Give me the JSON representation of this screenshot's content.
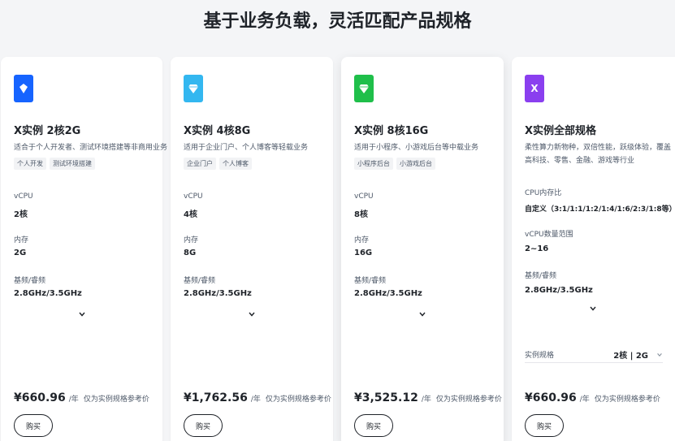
{
  "page_title": "基于业务负载，灵活匹配产品规格",
  "cards": [
    {
      "icon": "diamond-icon",
      "icon_color": "#1664ff",
      "title": "X实例 2核2G",
      "desc": "适合于个人开发者、测试环境搭建等非商用业务",
      "tags": [
        "个人开发",
        "测试环境搭建"
      ],
      "specs": [
        {
          "label": "vCPU",
          "value": "2核"
        },
        {
          "label": "内存",
          "value": "2G"
        },
        {
          "label": "基频/睿频",
          "value": "2.8GHz/3.5GHz"
        }
      ],
      "price": "¥660.96",
      "unit": "/年",
      "note": "仅为实例规格参考价",
      "buy": "购买"
    },
    {
      "icon": "gem-icon",
      "icon_color": "#33b7f0",
      "title": "X实例 4核8G",
      "desc": "适用于企业门户、个人博客等轻载业务",
      "tags": [
        "企业门户",
        "个人博客"
      ],
      "specs": [
        {
          "label": "vCPU",
          "value": "4核"
        },
        {
          "label": "内存",
          "value": "8G"
        },
        {
          "label": "基频/睿频",
          "value": "2.8GHz/3.5GHz"
        }
      ],
      "price": "¥1,762.56",
      "unit": "/年",
      "note": "仅为实例规格参考价",
      "buy": "购买"
    },
    {
      "icon": "gem-icon",
      "icon_color": "#1fbf4a",
      "title": "X实例 8核16G",
      "desc": "适用于小程序、小游戏后台等中载业务",
      "tags": [
        "小程序后台",
        "小游戏后台"
      ],
      "specs": [
        {
          "label": "vCPU",
          "value": "8核"
        },
        {
          "label": "内存",
          "value": "16G"
        },
        {
          "label": "基频/睿频",
          "value": "2.8GHz/3.5GHz"
        }
      ],
      "price": "¥3,525.12",
      "unit": "/年",
      "note": "仅为实例规格参考价",
      "buy": "购买"
    },
    {
      "icon_letter": "X",
      "icon_color": "#8a3fef",
      "title": "X实例全部规格",
      "desc": "柔性算力新物种，双倍性能，跃级体验，覆盖高科技、零售、金融、游戏等行业",
      "specs": [
        {
          "label": "CPU内存比",
          "value": "自定义（3:1/1:1/1:2/1:4/1:6/2:3/1:8等）"
        },
        {
          "label": "vCPU数量范围",
          "value": "2~16"
        },
        {
          "label": "基频/睿频",
          "value": "2.8GHz/3.5GHz"
        }
      ],
      "select_label": "实例规格",
      "select_value": "2核 | 2G",
      "price": "¥660.96",
      "unit": "/年",
      "note": "仅为实例规格参考价",
      "buy": "购买"
    }
  ]
}
